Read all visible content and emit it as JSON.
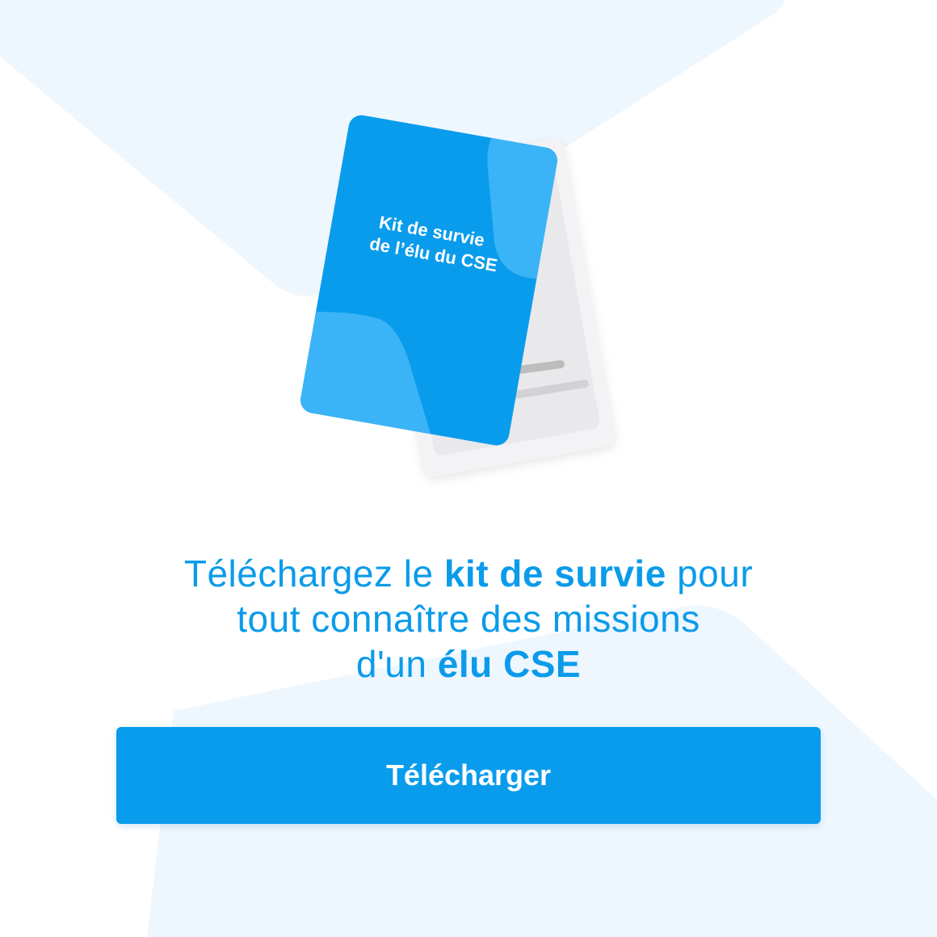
{
  "colors": {
    "accent": "#0a9cec",
    "accent_light": "#3bb3f7",
    "background": "#ffffff",
    "background_shape": "#eef6fe",
    "paper_back": "#f1f1f3",
    "paper_line": "#bdbdbd"
  },
  "book": {
    "title_line_1": "Kit de survie",
    "title_line_2": "de l’élu du CSE"
  },
  "headline": {
    "line1_prefix": "Téléchargez le ",
    "line1_bold": "kit de survie",
    "line1_suffix": " pour",
    "line2": "tout connaître des missions",
    "line3_prefix": "d'un ",
    "line3_bold": "élu CSE"
  },
  "cta": {
    "label": "Télécharger"
  }
}
